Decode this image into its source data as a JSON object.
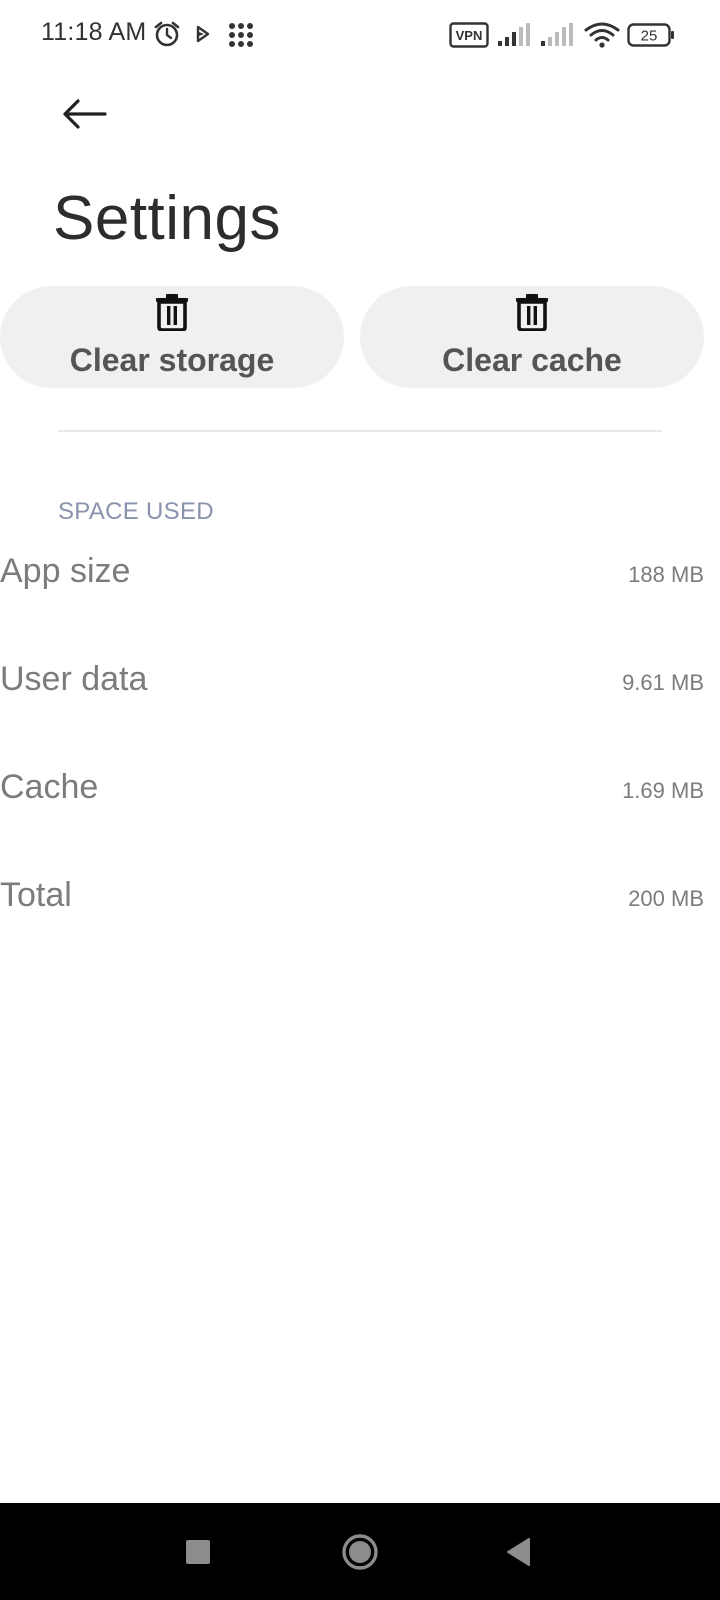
{
  "status_bar": {
    "time": "11:18 AM",
    "vpn_label": "VPN",
    "battery_level": "25",
    "icons": [
      "alarm-icon",
      "play-icon",
      "apps-grid-icon",
      "vpn-icon",
      "signal-icon",
      "signal-icon",
      "wifi-icon",
      "battery-icon"
    ]
  },
  "header": {
    "back_icon": "back-arrow-icon",
    "title": "Settings"
  },
  "actions": {
    "clear_storage_label": "Clear storage",
    "clear_cache_label": "Clear cache",
    "icon": "trash-icon"
  },
  "space_used": {
    "header": "SPACE USED",
    "rows": [
      {
        "label": "App size",
        "value": "188 MB"
      },
      {
        "label": "User data",
        "value": "9.61 MB"
      },
      {
        "label": "Cache",
        "value": "1.69 MB"
      },
      {
        "label": "Total",
        "value": "200 MB"
      }
    ]
  },
  "nav_bar": {
    "icons": [
      "recents-square-icon",
      "home-circle-icon",
      "back-triangle-icon"
    ]
  },
  "colors": {
    "background": "#ffffff",
    "button_bg": "#f0f0f0",
    "section_header": "#8a92ad",
    "text_muted": "#7c7c7c",
    "nav_bar": "#000000"
  }
}
